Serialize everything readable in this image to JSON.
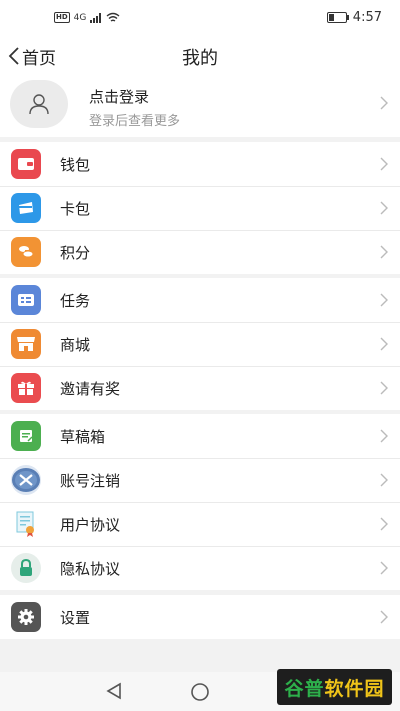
{
  "status_bar": {
    "hd": "HD",
    "network": "4G",
    "time": "4:57",
    "battery_level": 0.35
  },
  "nav": {
    "back_label": "首页",
    "title": "我的"
  },
  "profile": {
    "title": "点击登录",
    "subtitle": "登录后查看更多"
  },
  "menu": {
    "wallet": {
      "label": "钱包",
      "icon": "wallet-icon",
      "color": "#e9484f"
    },
    "card": {
      "label": "卡包",
      "icon": "card-icon",
      "color": "#2d98e8"
    },
    "points": {
      "label": "积分",
      "icon": "coins-icon",
      "color": "#f29334"
    },
    "tasks": {
      "label": "任务",
      "icon": "task-icon",
      "color": "#5b86d8"
    },
    "mall": {
      "label": "商城",
      "icon": "store-icon",
      "color": "#ef8a33"
    },
    "invite": {
      "label": "邀请有奖",
      "icon": "gift-icon",
      "color": "#ea4c4f"
    },
    "drafts": {
      "label": "草稿箱",
      "icon": "draft-icon",
      "color": "#4caf50"
    },
    "deactivate": {
      "label": "账号注销",
      "icon": "x-circle-icon",
      "color": "#5a7fb5"
    },
    "agreement": {
      "label": "用户协议",
      "icon": "certificate-icon",
      "color": "#7fc8dc"
    },
    "privacy": {
      "label": "隐私协议",
      "icon": "lock-icon",
      "color": "#2ea57a"
    },
    "settings": {
      "label": "设置",
      "icon": "gear-icon",
      "color": "#555555"
    }
  },
  "watermark": {
    "part1": "谷普",
    "part2": "软件园"
  }
}
